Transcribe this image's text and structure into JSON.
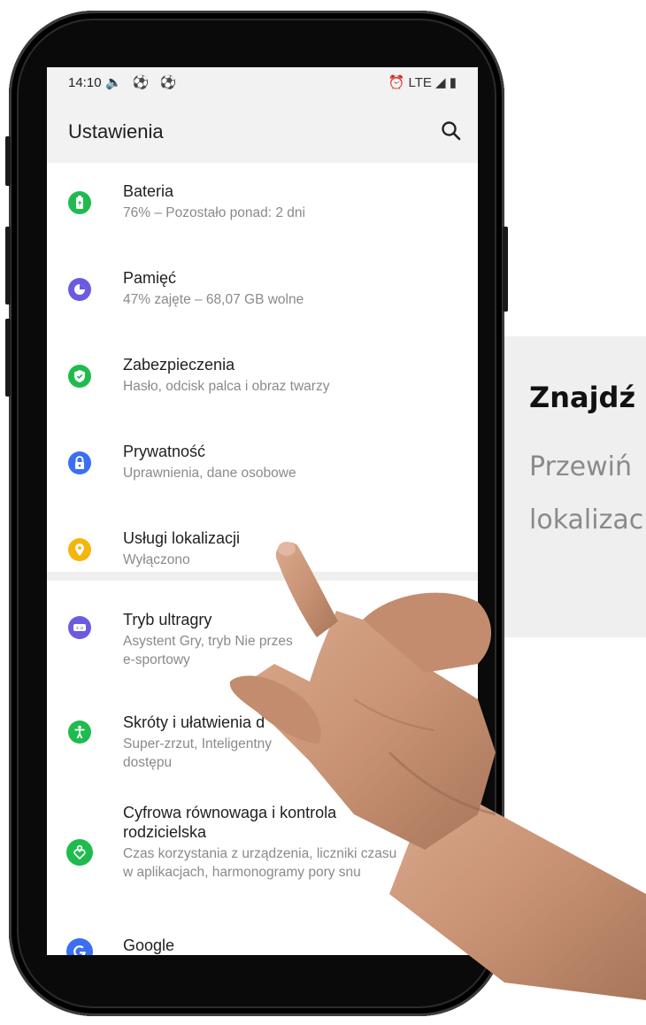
{
  "statusbar": {
    "time": "14:10",
    "left_icons": "🔈 ⚽ ⚽",
    "right": "⏰ LTE ◢ ▮"
  },
  "appbar": {
    "title": "Ustawienia"
  },
  "settings": [
    {
      "title": "Bateria",
      "subtitle": "76% – Pozostało ponad: 2 dni",
      "icon": "battery-icon",
      "color": "#1fbb4f"
    },
    {
      "title": "Pamięć",
      "subtitle": "47% zajęte – 68,07 GB wolne",
      "icon": "storage-icon",
      "color": "#6a5be0"
    },
    {
      "title": "Zabezpieczenia",
      "subtitle": "Hasło, odcisk palca i obraz twarzy",
      "icon": "shield-icon",
      "color": "#1fbb4f"
    },
    {
      "title": "Prywatność",
      "subtitle": "Uprawnienia, dane osobowe",
      "icon": "lock-icon",
      "color": "#3a6ff0"
    },
    {
      "title": "Usługi lokalizacji",
      "subtitle": "Wyłączono",
      "icon": "location-icon",
      "color": "#f5b50c"
    },
    {
      "title": "Tryb ultragry",
      "subtitle_line1": "Asystent Gry, tryb Nie przes",
      "subtitle_line2": "e-sportowy",
      "icon": "game-icon",
      "color": "#6a5be0"
    },
    {
      "title": "Skróty i ułatwienia d",
      "subtitle_line1": "Super-zrzut, Inteligentny",
      "subtitle_line2": "dostępu",
      "icon": "accessibility-icon",
      "color": "#1fbb4f"
    },
    {
      "title_line1": "Cyfrowa równowaga i kontrola",
      "title_line2": "rodzicielska",
      "subtitle_line1": "Czas korzystania z urządzenia, liczniki czasu",
      "subtitle_line2": "w aplikacjach, harmonogramy pory snu",
      "icon": "wellbeing-icon",
      "color": "#1fbb4f"
    },
    {
      "title": "Google",
      "icon": "google-icon",
      "color": "#3a6ff0"
    }
  ],
  "callout": {
    "title": "Znajdź",
    "line1": "Przewiń",
    "line2": "lokalizac"
  }
}
